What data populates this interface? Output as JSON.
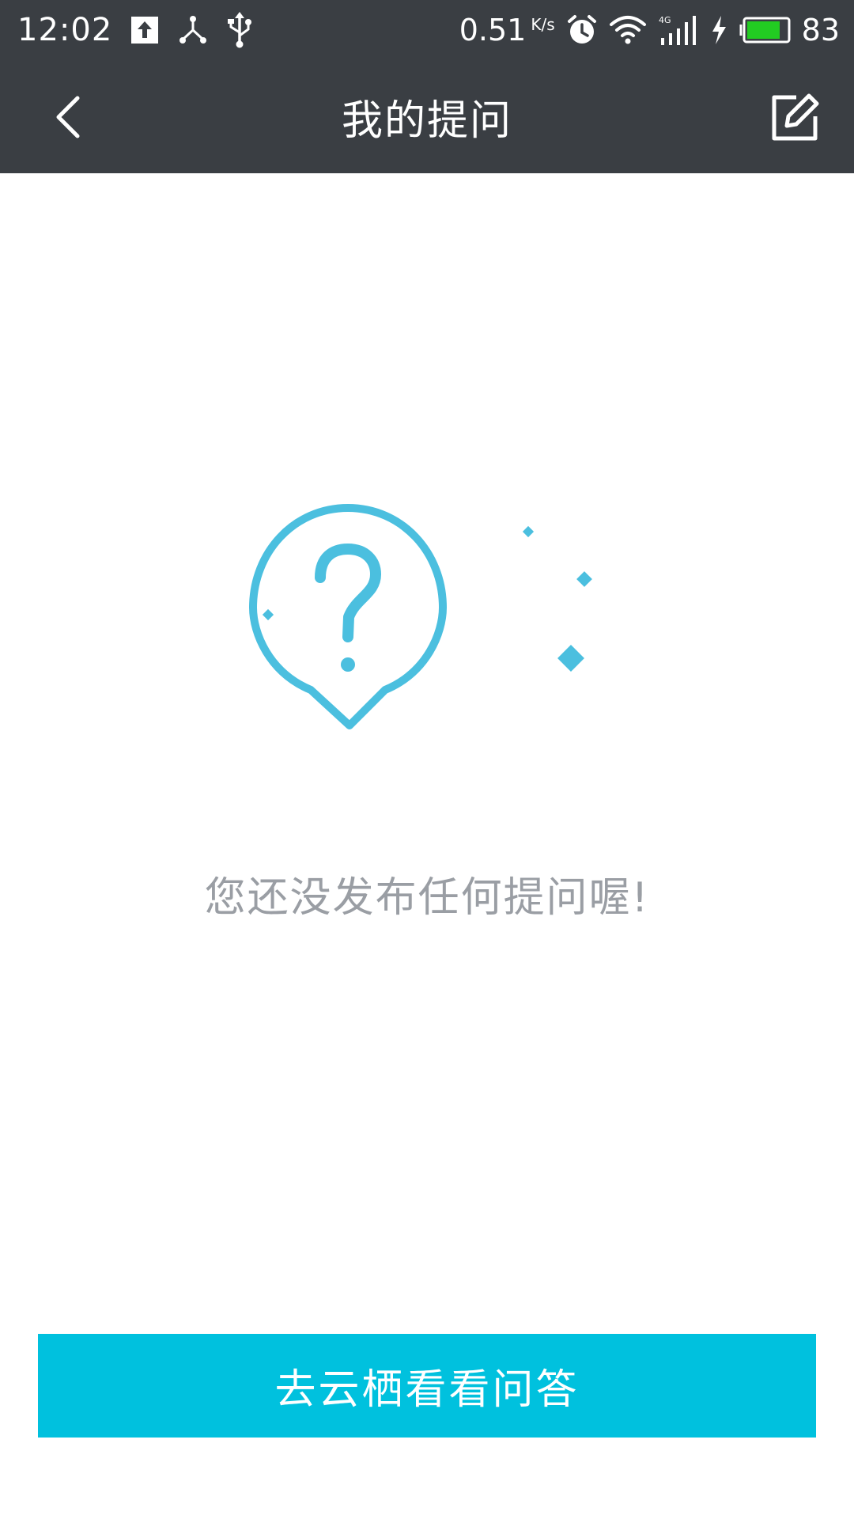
{
  "status_bar": {
    "time": "12:02",
    "network_speed": "0.51",
    "network_speed_unit": "K/s",
    "network_type": "4G",
    "battery_percent": "83",
    "battery_level": 0.83,
    "battery_color": "#22cc22",
    "icons": [
      "upload-notification-icon",
      "share-network-icon",
      "usb-icon",
      "alarm-icon",
      "wifi-icon",
      "cellular-signal-icon",
      "charging-icon",
      "battery-icon"
    ]
  },
  "header": {
    "title": "我的提问",
    "background": "#3a3e43",
    "back_icon": "chevron-left-icon",
    "compose_icon": "edit-icon"
  },
  "empty_state": {
    "illustration_icon": "question-bubble-icon",
    "accent_color": "#4bbfdf",
    "message": "您还没发布任何提问喔!"
  },
  "cta": {
    "label": "去云栖看看问答",
    "color": "#00c1de"
  }
}
